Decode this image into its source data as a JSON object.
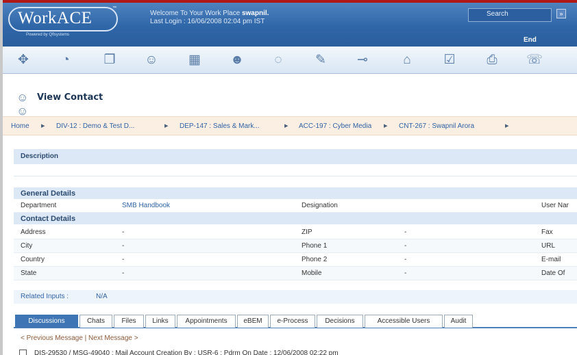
{
  "header": {
    "logo": "WorkACE",
    "logo_tm": "™",
    "logo_sub": "Powered by Qflsystems",
    "welcome_prefix": "Welcome To Your Work Place ",
    "username": "swapnil.",
    "last_login": "Last Login : 16/06/2008 02:04 pm IST",
    "search_label": "Search",
    "search_go": "»",
    "end_label": "End"
  },
  "toolbar": {
    "icons": [
      "compass-icon",
      "dashboard-icon",
      "documents-icon",
      "users-icon",
      "calendar-icon",
      "contact-icon",
      "chat-icon",
      "note-icon",
      "plug-icon",
      "building-icon",
      "report-icon",
      "print-icon",
      "people-chat-icon"
    ]
  },
  "page": {
    "title": "View Contact"
  },
  "breadcrumb": {
    "items": [
      "Home",
      "DIV-12 : Demo & Test D...",
      "DEP-147 : Sales & Mark...",
      "ACC-197 : Cyber Media",
      "CNT-267 : Swapnil Arora"
    ],
    "separator": "▸"
  },
  "sections": {
    "description": "Description",
    "general": "General Details",
    "contact": "Contact Details"
  },
  "general_row": {
    "department_label": "Department",
    "department_value": "SMB Handbook",
    "designation_label": "Designation",
    "designation_value": "",
    "username_label": "User Nar"
  },
  "contact_rows": [
    {
      "l1": "Address",
      "v1": "-",
      "l2": "ZIP",
      "v2": "-",
      "l3": "Fax"
    },
    {
      "l1": "City",
      "v1": "-",
      "l2": "Phone 1",
      "v2": "-",
      "l3": "URL"
    },
    {
      "l1": "Country",
      "v1": "-",
      "l2": "Phone 2",
      "v2": "-",
      "l3": "E-mail"
    },
    {
      "l1": "State",
      "v1": "-",
      "l2": "Mobile",
      "v2": "-",
      "l3": "Date Of"
    }
  ],
  "related": {
    "label": "Related Inputs :",
    "value": "N/A"
  },
  "tabs": [
    "Discussions",
    "Chats",
    "Files",
    "Links",
    "Appointments",
    "eBEM",
    "e-Process",
    "Decisions",
    "Accessible Users",
    "Audit"
  ],
  "messages": {
    "nav": "< Previous Message | Next Message >",
    "row_text": "DIS-29530 / MSG-49040 : Mail Account Creation   By : USR-6 : Pdrm   On   Date : 12/06/2008 02:22 pm"
  },
  "colors": {
    "header_blue": "#2f66a8",
    "accent_red": "#b01818",
    "tab_active": "#3d75b5",
    "section_bg": "#dce8f5",
    "breadcrumb_bg": "#fbeee2"
  }
}
